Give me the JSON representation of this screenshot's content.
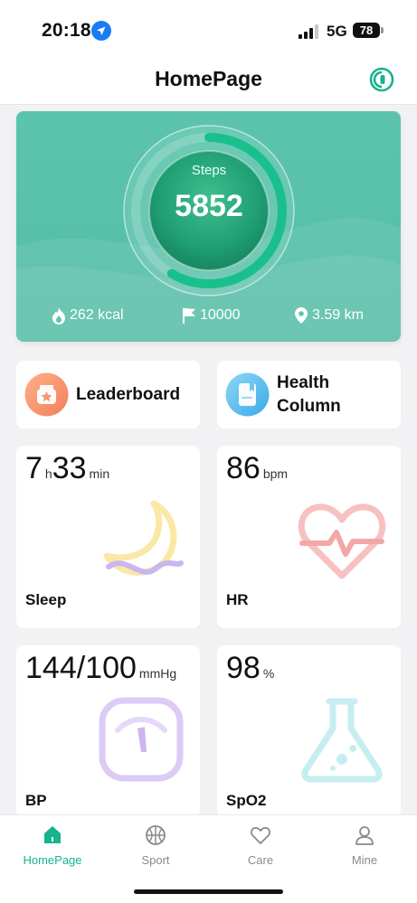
{
  "status_bar": {
    "time": "20:18",
    "network": "5G",
    "battery": "78"
  },
  "header": {
    "title": "HomePage",
    "device_icon": "watch-connect-icon"
  },
  "steps_card": {
    "label": "Steps",
    "value": "5852",
    "goal_progress": 0.585,
    "stats": {
      "calories": "262 kcal",
      "goal": "10000",
      "distance": "3.59 km"
    }
  },
  "features": {
    "leaderboard": {
      "label": "Leaderboard",
      "icon": "trophy-icon"
    },
    "health_column": {
      "label": "Health Column",
      "icon": "book-icon"
    }
  },
  "metrics": {
    "sleep": {
      "hours": "7",
      "hours_unit": "h",
      "minutes": "33",
      "minutes_unit": "min",
      "name": "Sleep"
    },
    "hr": {
      "value": "86",
      "unit": "bpm",
      "name": "HR"
    },
    "bp": {
      "value": "144/100",
      "unit": "mmHg",
      "name": "BP"
    },
    "spo2": {
      "value": "98",
      "unit": "%",
      "name": "SpO2"
    }
  },
  "tabs": [
    {
      "label": "HomePage",
      "icon": "home-icon",
      "active": true
    },
    {
      "label": "Sport",
      "icon": "ball-icon",
      "active": false
    },
    {
      "label": "Care",
      "icon": "heart-icon",
      "active": false
    },
    {
      "label": "Mine",
      "icon": "person-icon",
      "active": false
    }
  ],
  "colors": {
    "accent": "#16b38f",
    "card_green": "#5cc4ad"
  }
}
